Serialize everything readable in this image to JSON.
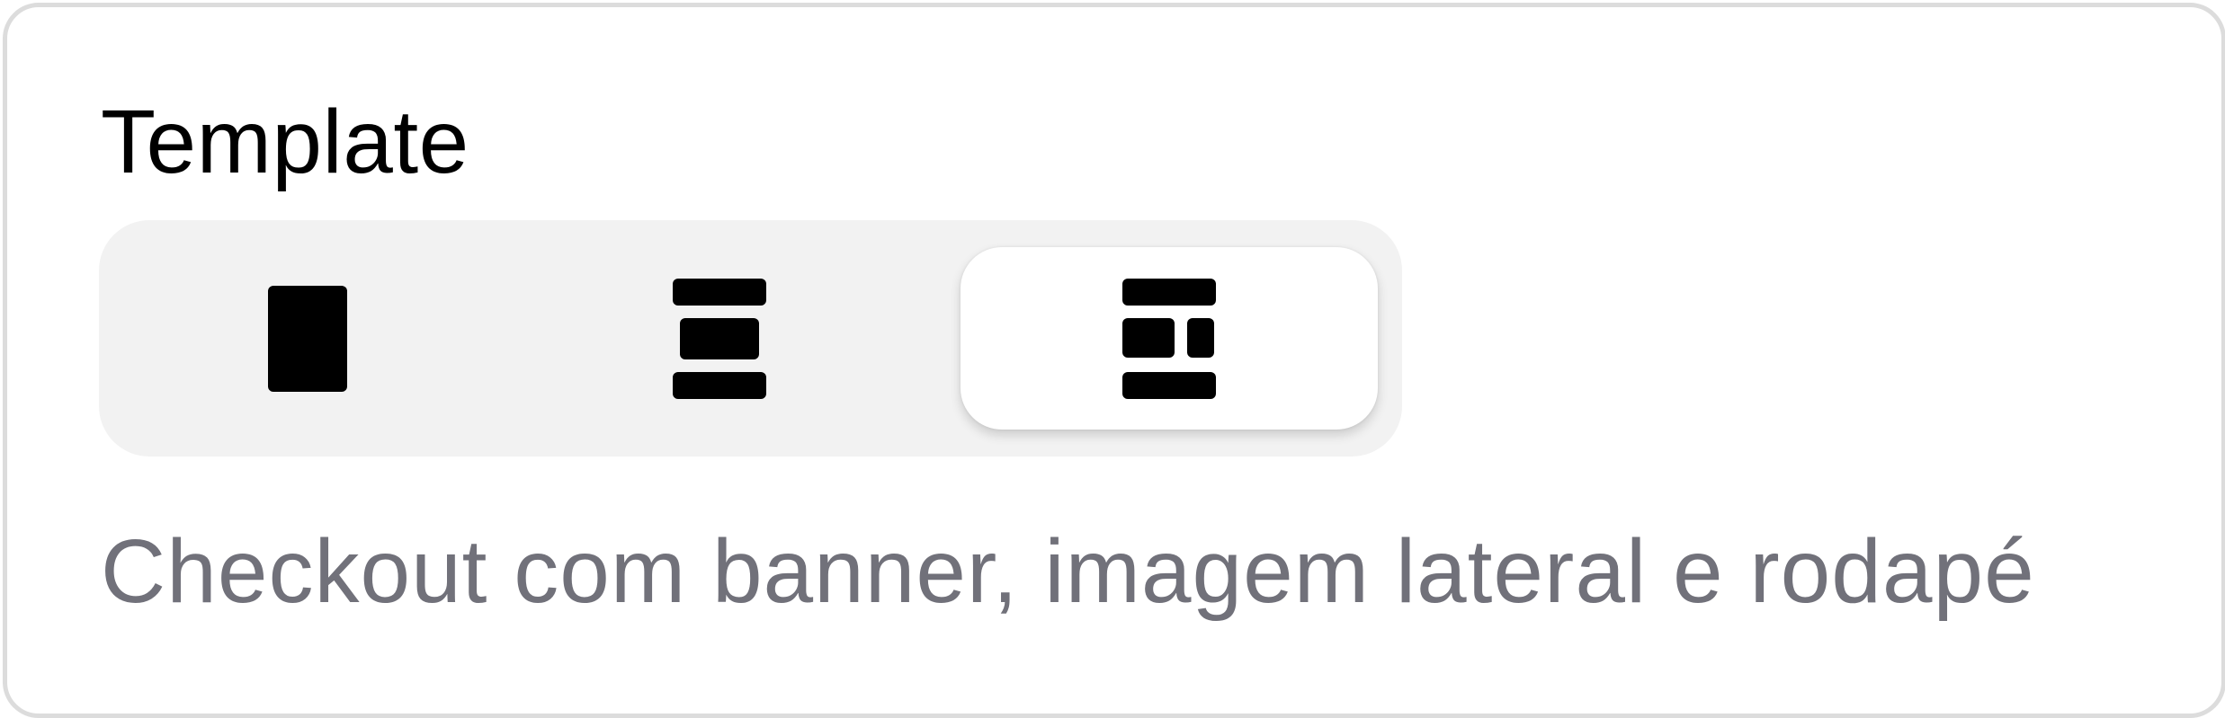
{
  "template_picker": {
    "label": "Template",
    "options": [
      {
        "id": "single",
        "icon": "layout-single-block-icon",
        "selected": false
      },
      {
        "id": "banner-footer",
        "icon": "layout-banner-content-footer-icon",
        "selected": false
      },
      {
        "id": "banner-side-footer",
        "icon": "layout-banner-split-footer-icon",
        "selected": true
      }
    ],
    "description": "Checkout com banner, imagem lateral e rodapé"
  },
  "colors": {
    "text_primary": "#000000",
    "text_muted": "#71717a",
    "track_background": "#f2f2f2",
    "selected_background": "#ffffff",
    "border": "#dcdcdc"
  }
}
